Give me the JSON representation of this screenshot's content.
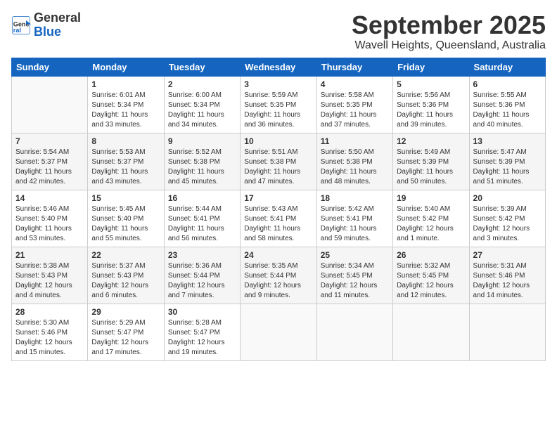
{
  "header": {
    "logo_general": "General",
    "logo_blue": "Blue",
    "month": "September 2025",
    "location": "Wavell Heights, Queensland, Australia"
  },
  "days_of_week": [
    "Sunday",
    "Monday",
    "Tuesday",
    "Wednesday",
    "Thursday",
    "Friday",
    "Saturday"
  ],
  "weeks": [
    [
      {
        "day": "",
        "info": ""
      },
      {
        "day": "1",
        "info": "Sunrise: 6:01 AM\nSunset: 5:34 PM\nDaylight: 11 hours\nand 33 minutes."
      },
      {
        "day": "2",
        "info": "Sunrise: 6:00 AM\nSunset: 5:34 PM\nDaylight: 11 hours\nand 34 minutes."
      },
      {
        "day": "3",
        "info": "Sunrise: 5:59 AM\nSunset: 5:35 PM\nDaylight: 11 hours\nand 36 minutes."
      },
      {
        "day": "4",
        "info": "Sunrise: 5:58 AM\nSunset: 5:35 PM\nDaylight: 11 hours\nand 37 minutes."
      },
      {
        "day": "5",
        "info": "Sunrise: 5:56 AM\nSunset: 5:36 PM\nDaylight: 11 hours\nand 39 minutes."
      },
      {
        "day": "6",
        "info": "Sunrise: 5:55 AM\nSunset: 5:36 PM\nDaylight: 11 hours\nand 40 minutes."
      }
    ],
    [
      {
        "day": "7",
        "info": "Sunrise: 5:54 AM\nSunset: 5:37 PM\nDaylight: 11 hours\nand 42 minutes."
      },
      {
        "day": "8",
        "info": "Sunrise: 5:53 AM\nSunset: 5:37 PM\nDaylight: 11 hours\nand 43 minutes."
      },
      {
        "day": "9",
        "info": "Sunrise: 5:52 AM\nSunset: 5:38 PM\nDaylight: 11 hours\nand 45 minutes."
      },
      {
        "day": "10",
        "info": "Sunrise: 5:51 AM\nSunset: 5:38 PM\nDaylight: 11 hours\nand 47 minutes."
      },
      {
        "day": "11",
        "info": "Sunrise: 5:50 AM\nSunset: 5:38 PM\nDaylight: 11 hours\nand 48 minutes."
      },
      {
        "day": "12",
        "info": "Sunrise: 5:49 AM\nSunset: 5:39 PM\nDaylight: 11 hours\nand 50 minutes."
      },
      {
        "day": "13",
        "info": "Sunrise: 5:47 AM\nSunset: 5:39 PM\nDaylight: 11 hours\nand 51 minutes."
      }
    ],
    [
      {
        "day": "14",
        "info": "Sunrise: 5:46 AM\nSunset: 5:40 PM\nDaylight: 11 hours\nand 53 minutes."
      },
      {
        "day": "15",
        "info": "Sunrise: 5:45 AM\nSunset: 5:40 PM\nDaylight: 11 hours\nand 55 minutes."
      },
      {
        "day": "16",
        "info": "Sunrise: 5:44 AM\nSunset: 5:41 PM\nDaylight: 11 hours\nand 56 minutes."
      },
      {
        "day": "17",
        "info": "Sunrise: 5:43 AM\nSunset: 5:41 PM\nDaylight: 11 hours\nand 58 minutes."
      },
      {
        "day": "18",
        "info": "Sunrise: 5:42 AM\nSunset: 5:41 PM\nDaylight: 11 hours\nand 59 minutes."
      },
      {
        "day": "19",
        "info": "Sunrise: 5:40 AM\nSunset: 5:42 PM\nDaylight: 12 hours\nand 1 minute."
      },
      {
        "day": "20",
        "info": "Sunrise: 5:39 AM\nSunset: 5:42 PM\nDaylight: 12 hours\nand 3 minutes."
      }
    ],
    [
      {
        "day": "21",
        "info": "Sunrise: 5:38 AM\nSunset: 5:43 PM\nDaylight: 12 hours\nand 4 minutes."
      },
      {
        "day": "22",
        "info": "Sunrise: 5:37 AM\nSunset: 5:43 PM\nDaylight: 12 hours\nand 6 minutes."
      },
      {
        "day": "23",
        "info": "Sunrise: 5:36 AM\nSunset: 5:44 PM\nDaylight: 12 hours\nand 7 minutes."
      },
      {
        "day": "24",
        "info": "Sunrise: 5:35 AM\nSunset: 5:44 PM\nDaylight: 12 hours\nand 9 minutes."
      },
      {
        "day": "25",
        "info": "Sunrise: 5:34 AM\nSunset: 5:45 PM\nDaylight: 12 hours\nand 11 minutes."
      },
      {
        "day": "26",
        "info": "Sunrise: 5:32 AM\nSunset: 5:45 PM\nDaylight: 12 hours\nand 12 minutes."
      },
      {
        "day": "27",
        "info": "Sunrise: 5:31 AM\nSunset: 5:46 PM\nDaylight: 12 hours\nand 14 minutes."
      }
    ],
    [
      {
        "day": "28",
        "info": "Sunrise: 5:30 AM\nSunset: 5:46 PM\nDaylight: 12 hours\nand 15 minutes."
      },
      {
        "day": "29",
        "info": "Sunrise: 5:29 AM\nSunset: 5:47 PM\nDaylight: 12 hours\nand 17 minutes."
      },
      {
        "day": "30",
        "info": "Sunrise: 5:28 AM\nSunset: 5:47 PM\nDaylight: 12 hours\nand 19 minutes."
      },
      {
        "day": "",
        "info": ""
      },
      {
        "day": "",
        "info": ""
      },
      {
        "day": "",
        "info": ""
      },
      {
        "day": "",
        "info": ""
      }
    ]
  ]
}
